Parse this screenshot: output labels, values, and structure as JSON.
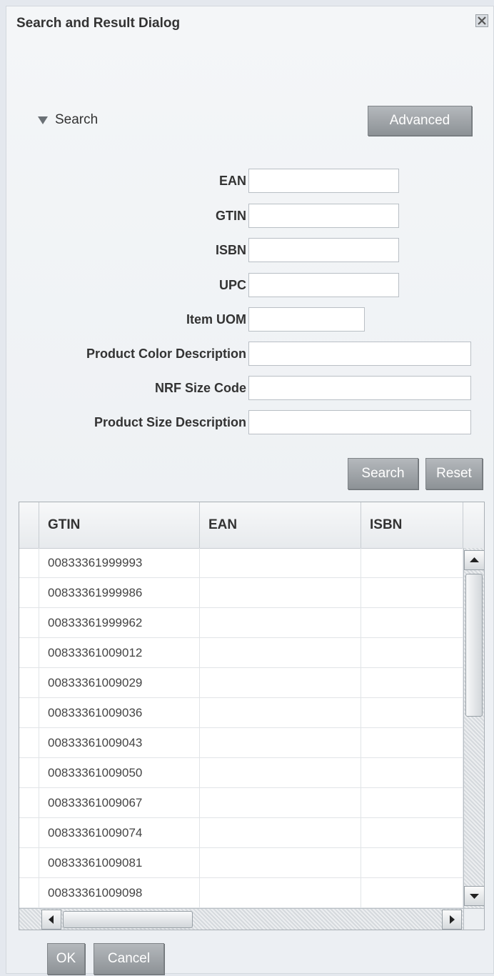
{
  "dialog": {
    "title": "Search and Result Dialog"
  },
  "search": {
    "toggle_label": "Search",
    "advanced_label": "Advanced",
    "fields": [
      {
        "label": "EAN",
        "value": ""
      },
      {
        "label": "GTIN",
        "value": ""
      },
      {
        "label": "ISBN",
        "value": ""
      },
      {
        "label": "UPC",
        "value": ""
      },
      {
        "label": "Item UOM",
        "value": ""
      },
      {
        "label": "Product Color Description",
        "value": ""
      },
      {
        "label": "NRF Size Code",
        "value": ""
      },
      {
        "label": "Product Size Description",
        "value": ""
      }
    ],
    "search_button": "Search",
    "reset_button": "Reset"
  },
  "results": {
    "columns": [
      "GTIN",
      "EAN",
      "ISBN"
    ],
    "rows": [
      [
        "00833361999993",
        "",
        ""
      ],
      [
        "00833361999986",
        "",
        ""
      ],
      [
        "00833361999962",
        "",
        ""
      ],
      [
        "00833361009012",
        "",
        ""
      ],
      [
        "00833361009029",
        "",
        ""
      ],
      [
        "00833361009036",
        "",
        ""
      ],
      [
        "00833361009043",
        "",
        ""
      ],
      [
        "00833361009050",
        "",
        ""
      ],
      [
        "00833361009067",
        "",
        ""
      ],
      [
        "00833361009074",
        "",
        ""
      ],
      [
        "00833361009081",
        "",
        ""
      ],
      [
        "00833361009098",
        "",
        ""
      ]
    ]
  },
  "footer": {
    "ok_label": "OK",
    "cancel_label": "Cancel"
  }
}
